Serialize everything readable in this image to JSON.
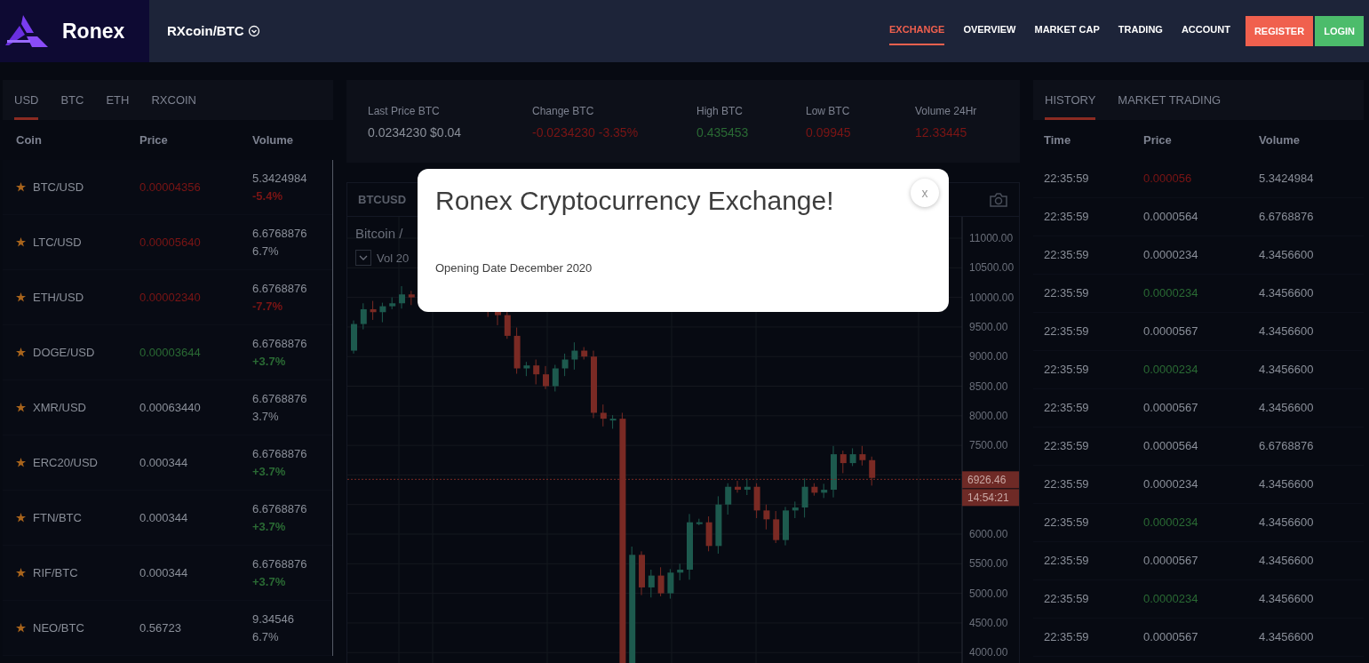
{
  "header": {
    "logo": "Ronex",
    "pair": "RXcoin/BTC",
    "nav": [
      {
        "label": "EXCHANGE",
        "selected": true
      },
      {
        "label": "OVERVIEW",
        "selected": false
      },
      {
        "label": "MARKET CAP",
        "selected": false
      },
      {
        "label": "TRADING",
        "selected": false
      },
      {
        "label": "ACCOUNT",
        "selected": false
      }
    ],
    "buttons": [
      {
        "label": "REGISTER",
        "kind": "register"
      },
      {
        "label": "LOGIN",
        "kind": "login"
      }
    ]
  },
  "markets": {
    "tabs": [
      {
        "label": "USD",
        "selected": true
      },
      {
        "label": "BTC",
        "selected": false
      },
      {
        "label": "ETH",
        "selected": false
      },
      {
        "label": "RXCOIN",
        "selected": false
      }
    ],
    "columns": [
      "Coin",
      "Price",
      "Volume"
    ],
    "rows": [
      {
        "pair": "BTC/USD",
        "price": {
          "value": "0.00004356",
          "color": "#7b1515"
        },
        "volume": "5.3424984",
        "change": {
          "value": "-5.4%",
          "color": "#7b1515"
        }
      },
      {
        "pair": "LTC/USD",
        "price": {
          "value": "0.00005640",
          "color": "#7b1515"
        },
        "volume": "6.6768876",
        "change": {
          "value": "6.7%",
          "color": "#8a8f99"
        }
      },
      {
        "pair": "ETH/USD",
        "price": {
          "value": "0.00002340",
          "color": "#7b1515"
        },
        "volume": "6.6768876",
        "change": {
          "value": "-7.7%",
          "color": "#7b1515"
        }
      },
      {
        "pair": "DOGE/USD",
        "price": {
          "value": "0.00003644",
          "color": "#2a6a34"
        },
        "volume": "6.6768876",
        "change": {
          "value": "+3.7%",
          "color": "#2a6a34"
        }
      },
      {
        "pair": "XMR/USD",
        "price": {
          "value": "0.00063440",
          "color": "#8a8f99"
        },
        "volume": "6.6768876",
        "change": {
          "value": "3.7%",
          "color": "#8a8f99"
        }
      },
      {
        "pair": "ERC20/USD",
        "price": {
          "value": "0.000344",
          "color": "#8a8f99"
        },
        "volume": "6.6768876",
        "change": {
          "value": "+3.7%",
          "color": "#2a6a34"
        }
      },
      {
        "pair": "FTN/BTC",
        "price": {
          "value": "0.000344",
          "color": "#8a8f99"
        },
        "volume": "6.6768876",
        "change": {
          "value": "+3.7%",
          "color": "#2a6a34"
        }
      },
      {
        "pair": "RIF/BTC",
        "price": {
          "value": "0.000344",
          "color": "#8a8f99"
        },
        "volume": "6.6768876",
        "change": {
          "value": "+3.7%",
          "color": "#2a6a34"
        }
      },
      {
        "pair": "NEO/BTC",
        "price": {
          "value": "0.56723",
          "color": "#8a8f99"
        },
        "volume": "9.34546",
        "change": {
          "value": "6.7%",
          "color": "#8a8f99"
        }
      }
    ]
  },
  "stats": [
    {
      "label": "Last Price BTC",
      "value": "0.0234230 $0.04",
      "color": "#8a8f99"
    },
    {
      "label": "Change BTC",
      "value": "-0.0234230 -3.35%",
      "color": "#7b1515"
    },
    {
      "label": "High BTC",
      "value": "0.435453",
      "color": "#2a6a34"
    },
    {
      "label": "Low BTC",
      "value": "0.09945",
      "color": "#7b1515"
    },
    {
      "label": "Volume 24Hr",
      "value": "12.33445",
      "color": "#7b1515"
    }
  ],
  "chart": {
    "symbol": "BTCUSD",
    "title": "Bitcoin /",
    "indicator": "Vol 20",
    "axis_labels": [
      "11000.00",
      "10500.00",
      "10000.00",
      "9500.00",
      "9000.00",
      "8500.00",
      "8000.00",
      "7500.00",
      "6000.00",
      "5500.00",
      "5000.00",
      "4500.00",
      "4000.00"
    ],
    "price_tag": "6926.46",
    "time_tag": "14:54:21"
  },
  "history": {
    "tabs": [
      {
        "label": "HISTORY",
        "selected": true
      },
      {
        "label": "MARKET TRADING",
        "selected": false
      }
    ],
    "columns": [
      "Time",
      "Price",
      "Volume"
    ],
    "rows": [
      {
        "time": "22:35:59",
        "price": {
          "value": "0.000056",
          "color": "#7b1515"
        },
        "volume": "5.3424984"
      },
      {
        "time": "22:35:59",
        "price": {
          "value": "0.0000564",
          "color": "#8a8f99"
        },
        "volume": "6.6768876"
      },
      {
        "time": "22:35:59",
        "price": {
          "value": "0.0000234",
          "color": "#8a8f99"
        },
        "volume": "4.3456600"
      },
      {
        "time": "22:35:59",
        "price": {
          "value": "0.0000234",
          "color": "#2a6a34"
        },
        "volume": "4.3456600"
      },
      {
        "time": "22:35:59",
        "price": {
          "value": "0.0000567",
          "color": "#8a8f99"
        },
        "volume": "4.3456600"
      },
      {
        "time": "22:35:59",
        "price": {
          "value": "0.0000234",
          "color": "#2a6a34"
        },
        "volume": "4.3456600"
      },
      {
        "time": "22:35:59",
        "price": {
          "value": "0.0000567",
          "color": "#8a8f99"
        },
        "volume": "4.3456600"
      },
      {
        "time": "22:35:59",
        "price": {
          "value": "0.0000564",
          "color": "#8a8f99"
        },
        "volume": "6.6768876"
      },
      {
        "time": "22:35:59",
        "price": {
          "value": "0.0000234",
          "color": "#8a8f99"
        },
        "volume": "4.3456600"
      },
      {
        "time": "22:35:59",
        "price": {
          "value": "0.0000234",
          "color": "#2a6a34"
        },
        "volume": "4.3456600"
      },
      {
        "time": "22:35:59",
        "price": {
          "value": "0.0000567",
          "color": "#8a8f99"
        },
        "volume": "4.3456600"
      },
      {
        "time": "22:35:59",
        "price": {
          "value": "0.0000234",
          "color": "#2a6a34"
        },
        "volume": "4.3456600"
      },
      {
        "time": "22:35:59",
        "price": {
          "value": "0.0000567",
          "color": "#8a8f99"
        },
        "volume": "4.3456600"
      }
    ]
  },
  "modal": {
    "title": "Ronex Cryptocurrency Exchange!",
    "text": "Opening Date December 2020",
    "close": "x"
  }
}
